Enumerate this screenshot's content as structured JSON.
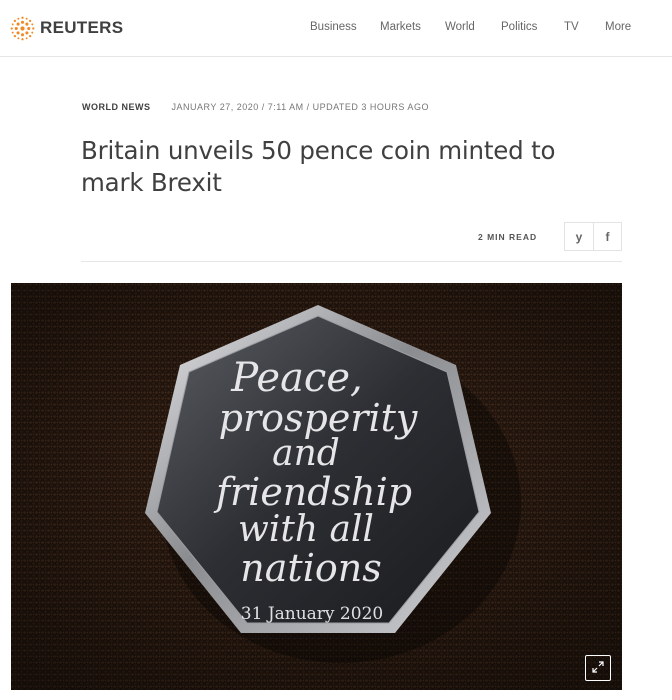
{
  "brand": {
    "name": "REUTERS",
    "logo_icon": "reuters-dots-logo",
    "accent": "#f08a24"
  },
  "nav": {
    "items": [
      "Business",
      "Markets",
      "World",
      "Politics",
      "TV",
      "More"
    ]
  },
  "article": {
    "section": "WORLD NEWS",
    "dateline": "JANUARY 27, 2020 / 7:11 AM / UPDATED 3 HOURS AGO",
    "headline": "Britain unveils 50 pence coin minted to mark Brexit",
    "read_time": "2 MIN READ",
    "share": {
      "twitter_icon": "twitter-icon",
      "facebook_icon": "facebook-icon",
      "twitter_glyph": "y",
      "facebook_glyph": "f"
    }
  },
  "photo": {
    "coin_inscription": [
      "Peace,",
      "prosperity",
      "and",
      "friendship",
      "with all",
      "nations"
    ],
    "coin_date": "31 January 2020",
    "expand_icon": "expand-icon"
  }
}
